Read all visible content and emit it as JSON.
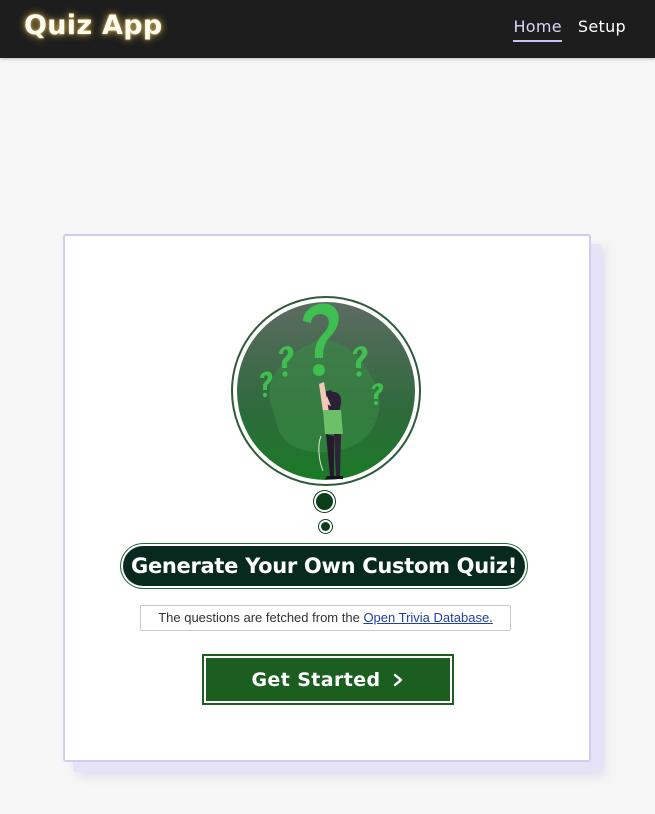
{
  "navbar": {
    "brand": "Quiz App",
    "links": [
      {
        "label": "Home",
        "active": true
      },
      {
        "label": "Setup",
        "active": false
      }
    ]
  },
  "hero": {
    "illustration": "question-marks-woman-illustration",
    "headline": "Generate Your Own Custom Quiz!",
    "source_prefix": "The questions are fetched from the ",
    "source_link": "Open Trivia Database.",
    "cta_label": "Get Started",
    "cta_icon": "chevron-right-icon"
  },
  "colors": {
    "navbar_bg": "#1c1d1c",
    "brand_glow": "#d9b65a",
    "accent_green": "#1b5e20",
    "headline_bg": "#082a1e",
    "card_border": "#d2cdef",
    "link": "#1c3fa8"
  }
}
